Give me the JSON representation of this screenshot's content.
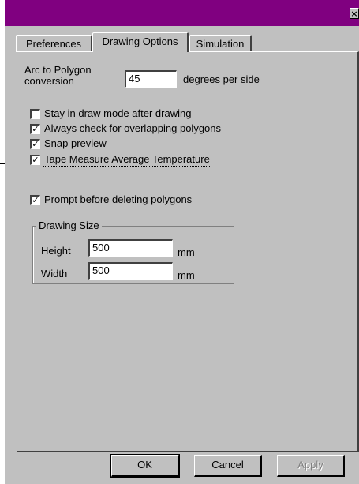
{
  "window": {
    "title": "",
    "close_glyph": "×",
    "colors": {
      "titlebar": "#800080",
      "face": "#c0c0c0"
    }
  },
  "tabs": [
    {
      "label": "Preferences",
      "active": false
    },
    {
      "label": "Drawing Options",
      "active": true
    },
    {
      "label": "Simulation",
      "active": false
    }
  ],
  "drawing_options": {
    "arc_label": "Arc to Polygon conversion",
    "arc_value": "45",
    "arc_units": "degrees per side",
    "checkboxes": [
      {
        "label": "Stay in draw mode after drawing",
        "checked": false
      },
      {
        "label": "Always check for overlapping polygons",
        "checked": true
      },
      {
        "label": "Snap preview",
        "checked": true
      },
      {
        "label": "Tape Measure Average Temperature",
        "checked": true
      },
      {
        "label": "Prompt before deleting polygons",
        "checked": true
      }
    ],
    "drawing_size": {
      "title": "Drawing Size",
      "height_label": "Height",
      "height_value": "500",
      "height_units": "mm",
      "width_label": "Width",
      "width_value": "500",
      "width_units": "mm"
    }
  },
  "buttons": {
    "ok": "OK",
    "cancel": "Cancel",
    "apply": "Apply"
  },
  "check_glyph": "✓"
}
